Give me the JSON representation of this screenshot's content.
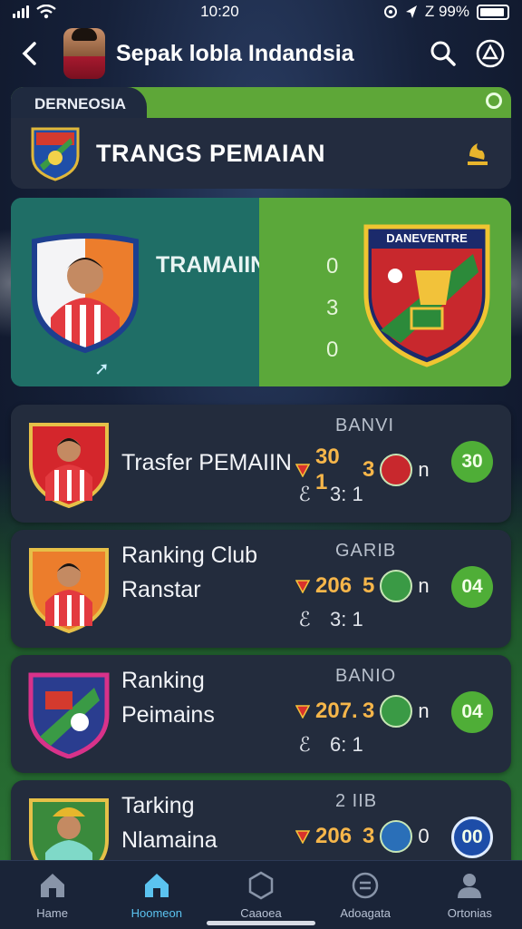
{
  "status_bar": {
    "time": "10:20",
    "right_text": "Z 99%"
  },
  "header": {
    "title": "Sepak lobla Indandsia"
  },
  "banner": {
    "tab_label": "DERNEOSIA",
    "title": "TRANGS PEMAIAN"
  },
  "match": {
    "label": "TRAMAIIN",
    "scores": [
      "0",
      "3",
      "0"
    ],
    "club_crest_text": "DANEVENTRE"
  },
  "list": [
    {
      "name_lines": [
        "Trasfer PEMAIIN"
      ],
      "tag": "BANVI",
      "value": "30 1",
      "rank": "3",
      "suffix": "n",
      "pill": "30",
      "pill_style": "green",
      "sub_icon": "ℰ",
      "sub_text": "3: 1"
    },
    {
      "name_lines": [
        "Ranking Club",
        "Ranstar"
      ],
      "tag": "GARIB",
      "value": "206",
      "rank": "5",
      "suffix": "n",
      "pill": "04",
      "pill_style": "green",
      "sub_icon": "ℰ",
      "sub_text": "3: 1"
    },
    {
      "name_lines": [
        "Ranking",
        "Peimains"
      ],
      "tag": "BANIO",
      "value": "207.",
      "rank": "3",
      "suffix": "n",
      "pill": "04",
      "pill_style": "green",
      "sub_icon": "ℰ",
      "sub_text": "6: 1"
    },
    {
      "name_lines": [
        "Tarking",
        "Nlamaina"
      ],
      "tag": "2 IIB",
      "value": "206",
      "rank": "3",
      "suffix": "0",
      "pill": "00",
      "pill_style": "blue",
      "sub_icon": "",
      "sub_text": ""
    }
  ],
  "nav": [
    {
      "label": "Hame",
      "icon": "home-icon",
      "active": false
    },
    {
      "label": "Hoomeon",
      "icon": "home-icon",
      "active": true
    },
    {
      "label": "Caaoea",
      "icon": "hexagon-icon",
      "active": false
    },
    {
      "label": "Adoagata",
      "icon": "badge-icon",
      "active": false
    },
    {
      "label": "Ortonias",
      "icon": "user-icon",
      "active": false
    }
  ],
  "colors": {
    "accent_green": "#5ea738",
    "gold": "#f6b64a",
    "active_nav": "#5bc3f0"
  }
}
